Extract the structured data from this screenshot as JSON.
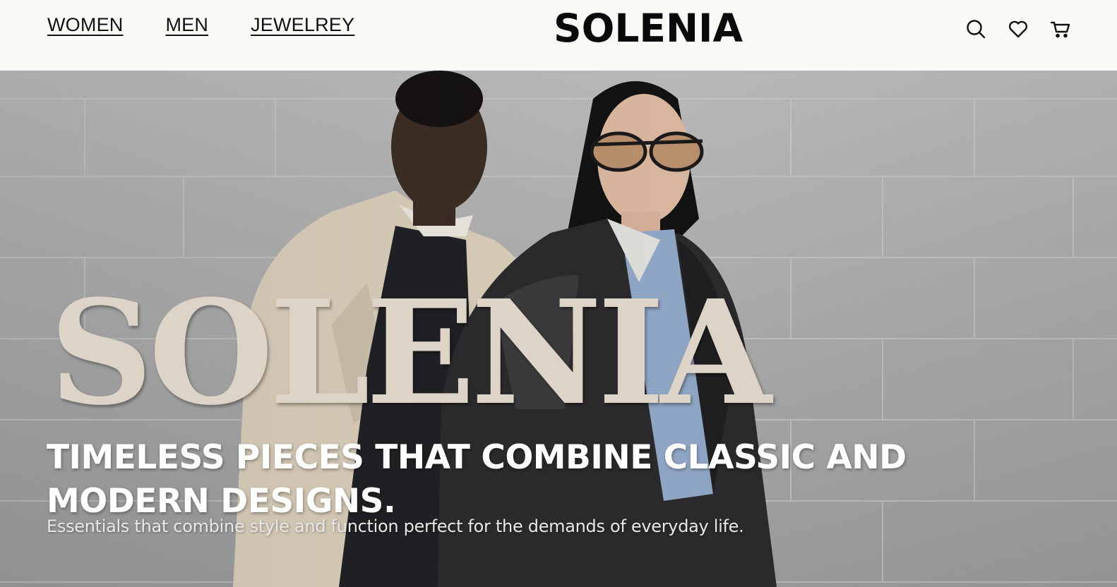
{
  "header": {
    "nav": [
      {
        "label": "WOMEN"
      },
      {
        "label": "MEN"
      },
      {
        "label": "JEWELREY"
      }
    ],
    "logo": "SOLENIA",
    "icons": [
      "search-icon",
      "heart-icon",
      "cart-icon"
    ]
  },
  "hero": {
    "title": "SOLENIA",
    "tagline": "TIMELESS PIECES THAT COMBINE CLASSIC AND MODERN DESIGNS.",
    "subtext": "Essentials that combine style and function perfect for the demands of everyday life."
  },
  "colors": {
    "header_bg": "#fbfaf7",
    "title_cream": "#ddd3c6",
    "text_dark": "#0a0a0a"
  }
}
